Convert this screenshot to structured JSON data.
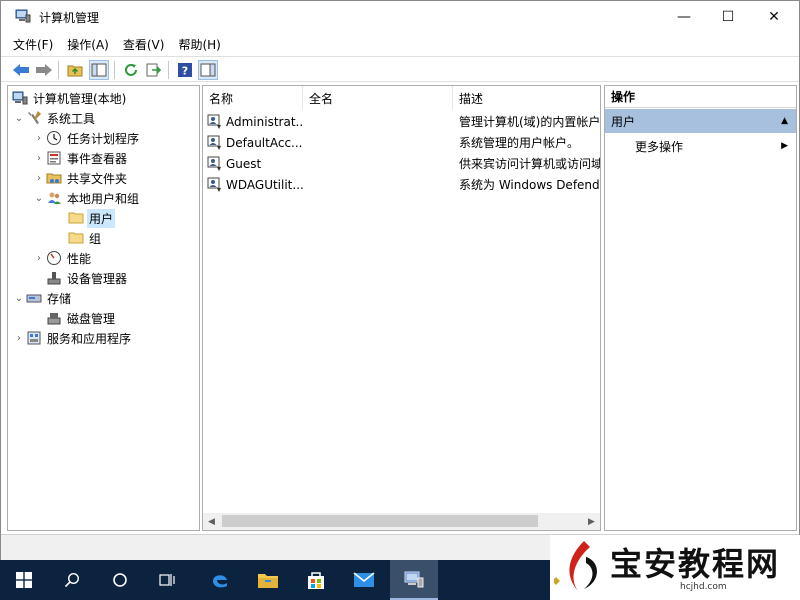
{
  "window": {
    "title": "计算机管理",
    "controls": {
      "minimize": "—",
      "maximize": "☐",
      "close": "✕"
    }
  },
  "menu": {
    "items": [
      "文件(F)",
      "操作(A)",
      "查看(V)",
      "帮助(H)"
    ]
  },
  "tree": {
    "root": "计算机管理(本地)",
    "system_tools": "系统工具",
    "task_scheduler": "任务计划程序",
    "event_viewer": "事件查看器",
    "shared_folders": "共享文件夹",
    "local_users": "本地用户和组",
    "users": "用户",
    "groups": "组",
    "performance": "性能",
    "device_manager": "设备管理器",
    "storage": "存储",
    "disk_management": "磁盘管理",
    "services_apps": "服务和应用程序"
  },
  "list": {
    "columns": [
      "名称",
      "全名",
      "描述"
    ],
    "rows": [
      {
        "name": "Administrat...",
        "fullname": "",
        "desc": "管理计算机(域)的内置帐户"
      },
      {
        "name": "DefaultAcc...",
        "fullname": "",
        "desc": "系统管理的用户帐户。"
      },
      {
        "name": "Guest",
        "fullname": "",
        "desc": "供来宾访问计算机或访问域"
      },
      {
        "name": "WDAGUtilit...",
        "fullname": "",
        "desc": "系统为 Windows Defender"
      }
    ]
  },
  "actions": {
    "title": "操作",
    "section": "用户",
    "more": "更多操作"
  },
  "watermark": {
    "text": "宝安教程网",
    "sub": "hcjhd.com"
  },
  "colors": {
    "taskbar": "#0c2340",
    "selection": "#cce8ff",
    "action_section": "#a7c0dd"
  }
}
